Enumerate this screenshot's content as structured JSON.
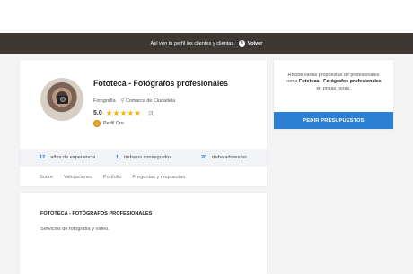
{
  "banner": {
    "message": "Así ven tu perfil los clientes y clientas.",
    "back_label": "Volver"
  },
  "profile": {
    "name": "Fototeca - Fotógrafos profesionales",
    "category": "Fotografía",
    "location": "Comarca de Ciudadela",
    "rating": "5.0",
    "stars": "★★★★★",
    "reviews_count": "(3)",
    "badge": "Perfil Oro"
  },
  "stats": [
    {
      "value": "12",
      "label": "años de experiencia"
    },
    {
      "value": "1",
      "label": "trabajos conseguidos"
    },
    {
      "value": "20",
      "label": "trabajadores/as"
    }
  ],
  "tabs": [
    "Sobre",
    "Valoraciones",
    "Portfolio",
    "Preguntas y respuestas"
  ],
  "sidebar": {
    "text_before": "Recibe varias propuestas de profesionales como",
    "text_bold": "Fototeca - Fotógrafos profesionales",
    "text_after": "en pocas horas.",
    "cta_label": "PEDIR PRESUPUESTOS"
  },
  "description": {
    "title": "FOTOTECA - FOTÓGRAFOS PROFESIONALES",
    "text": "Servicios de fotografía y vídeo."
  },
  "colors": {
    "banner_bg": "#3d3833",
    "accent_blue": "#2d7fd4",
    "star": "#f5b400"
  }
}
